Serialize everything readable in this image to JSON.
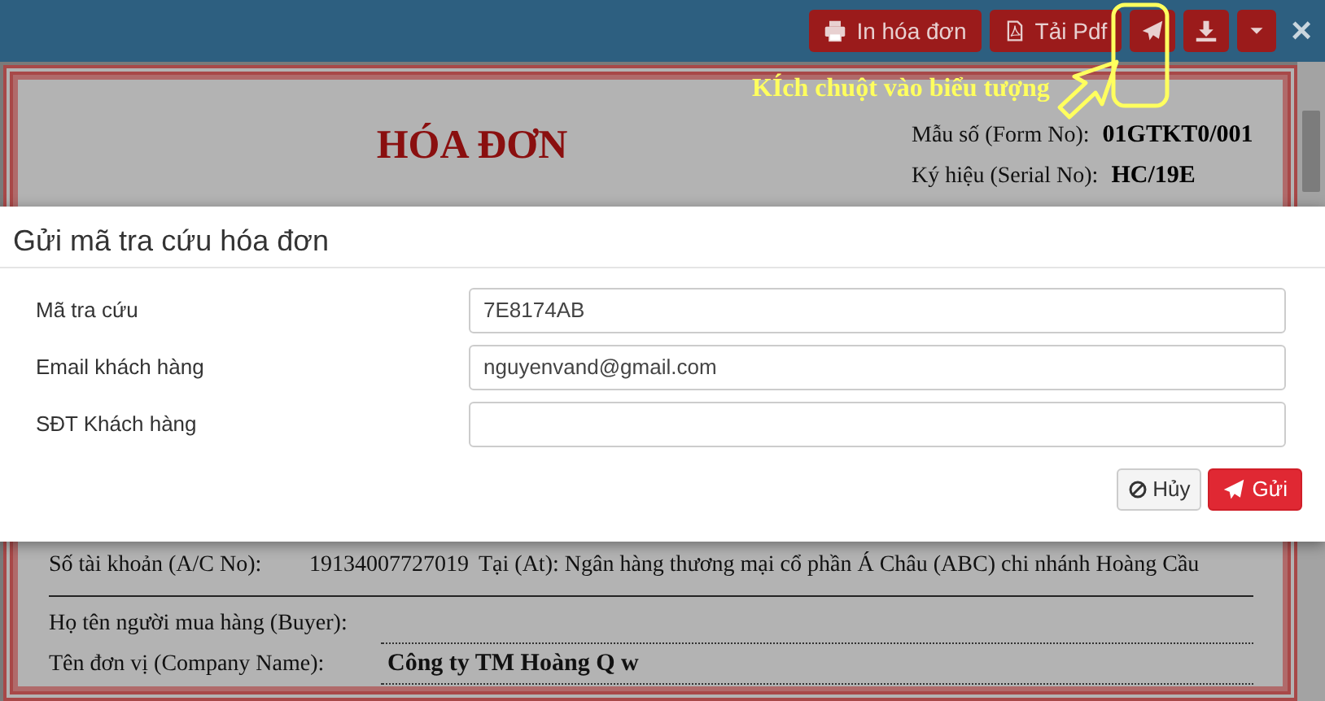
{
  "toolbar": {
    "buttons": [
      {
        "kind": "print",
        "label": "In hóa đơn"
      },
      {
        "kind": "pdf",
        "label": "Tải Pdf"
      },
      {
        "kind": "send"
      },
      {
        "kind": "download"
      },
      {
        "kind": "dropdown"
      }
    ],
    "close": "×"
  },
  "invoice": {
    "title": [
      "HÓA ĐƠN"
    ],
    "meta": [
      {
        "label": "Mẫu số (Form No):",
        "value": "01GTKT0/001",
        "color": "#000000"
      },
      {
        "label": "Ký hiệu (Serial No):",
        "value": "HC/19E",
        "color": "#000000"
      }
    ],
    "account": {
      "label": "Số tài khoản (A/C No):",
      "number": "19134007727019",
      "bank": "Tại (At): Ngân hàng thương mại cổ phần Á Châu (ABC) chi nhánh Hoàng Cầu"
    },
    "buyer_fields": [
      {
        "label": "Họ tên người mua hàng (Buyer):"
      },
      {
        "label": "Tên đơn vị (Company Name):",
        "value": "Công ty TM Hoàng Q w"
      }
    ]
  },
  "annotation": {
    "text": "KÍch chuột vào biểu tượng"
  },
  "modal": {
    "title": "Gửi mã tra cứu hóa đơn",
    "fields": [
      {
        "label": "Mã tra cứu",
        "value": "7E8174AB"
      },
      {
        "label": "Email khách hàng",
        "value": "nguyenvand@gmail.com"
      },
      {
        "label": "SĐT Khách hàng"
      }
    ],
    "buttons": [
      {
        "kind": "cancel",
        "label": "Hủy"
      },
      {
        "kind": "send",
        "label": "Gửi"
      }
    ]
  }
}
